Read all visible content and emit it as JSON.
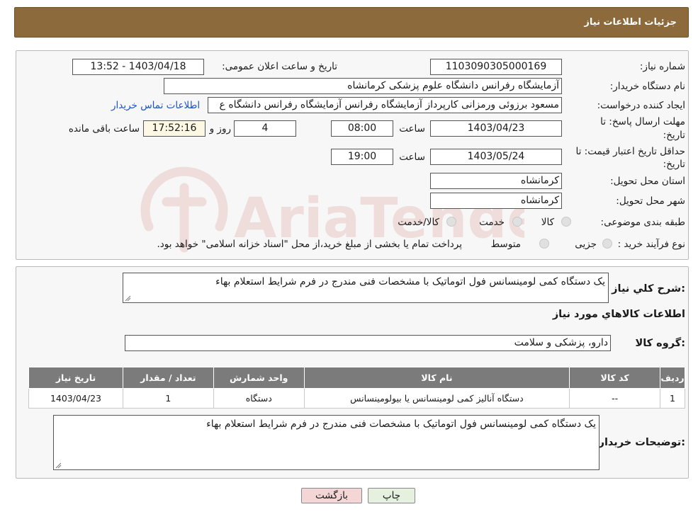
{
  "page_title": "جزئیات اطلاعات نیاز",
  "fields": {
    "need_number_label": "شماره نیاز:",
    "need_number": "1103090305000169",
    "announce_label": "تاریخ و ساعت اعلان عمومی:",
    "announce_value": "1403/04/18 - 13:52",
    "buyer_org_label": "نام دستگاه خریدار:",
    "buyer_org": "آزمایشگاه رفرانس دانشگاه علوم پزشکی کرمانشاه",
    "creator_label": "ایجاد کننده درخواست:",
    "creator": "مسعود برزوئی ورمزانی کارپرداز آزمایشگاه رفرانس آزمایشگاه رفرانس دانشگاه ع",
    "contact_link": "اطلاعات تماس خریدار",
    "deadline_label_1": "مهلت ارسال پاسخ: تا",
    "deadline_label_2": "تاریخ:",
    "deadline_date": "1403/04/23",
    "hour_label": "ساعت",
    "deadline_time": "08:00",
    "days_remaining": "4",
    "days_label": "روز و",
    "time_remaining": "17:52:16",
    "remaining_label": "ساعت باقی مانده",
    "validity_label_1": "حداقل تاریخ اعتبار قیمت: تا",
    "validity_label_2": "تاریخ:",
    "validity_date": "1403/05/24",
    "validity_time": "19:00",
    "province_label": "استان محل تحویل:",
    "province": "کرمانشاه",
    "city_label": "شهر محل تحویل:",
    "city": "کرمانشاه",
    "category_label": "طبقه بندی موضوعی:",
    "category_options": [
      "کالا",
      "خدمت",
      "کالا/خدمت"
    ],
    "process_label": "نوع فرآیند خرید :",
    "process_options": [
      "جزیی",
      "متوسط"
    ],
    "process_note": "پرداخت تمام یا بخشی از مبلغ خرید،از محل \"اسناد خزانه اسلامی\" خواهد بود."
  },
  "summary": {
    "label": "شرح کلي نياز:",
    "text": "یک دستگاه کمی لومینسانس فول اتوماتیک با مشخصات فنی مندرج در فرم شرایط استعلام بهاء"
  },
  "goods": {
    "section_title": "اطلاعات کالاهاي مورد نياز",
    "group_label": "گروه کالا:",
    "group_value": "دارو، پزشکی و سلامت",
    "table": {
      "headers": [
        "ردیف",
        "کد کالا",
        "نام کالا",
        "واحد شمارش",
        "تعداد / مقدار",
        "تاریخ نیاز"
      ],
      "rows": [
        [
          "1",
          "--",
          "دستگاه آنالیز کمی لومینسانس یا بیولومینسانس",
          "دستگاه",
          "1",
          "1403/04/23"
        ]
      ]
    },
    "buyer_notes_label": "توضیحات خریدار:",
    "buyer_notes": "یک دستگاه کمی لومینسانس فول اتوماتیک با مشخصات فنی مندرج در فرم شرایط استعلام بهاء"
  },
  "buttons": {
    "print": "چاپ",
    "back": "بازگشت"
  },
  "watermark_text": "AriaTender.neT",
  "colors": {
    "header_bg": "#8c6a3b",
    "table_header_bg": "#7b7b7b",
    "link": "#1b53c9",
    "back_button_bg": "#f4d6d6",
    "print_button_bg": "#e5f0df",
    "watermark": "#c0392b"
  }
}
